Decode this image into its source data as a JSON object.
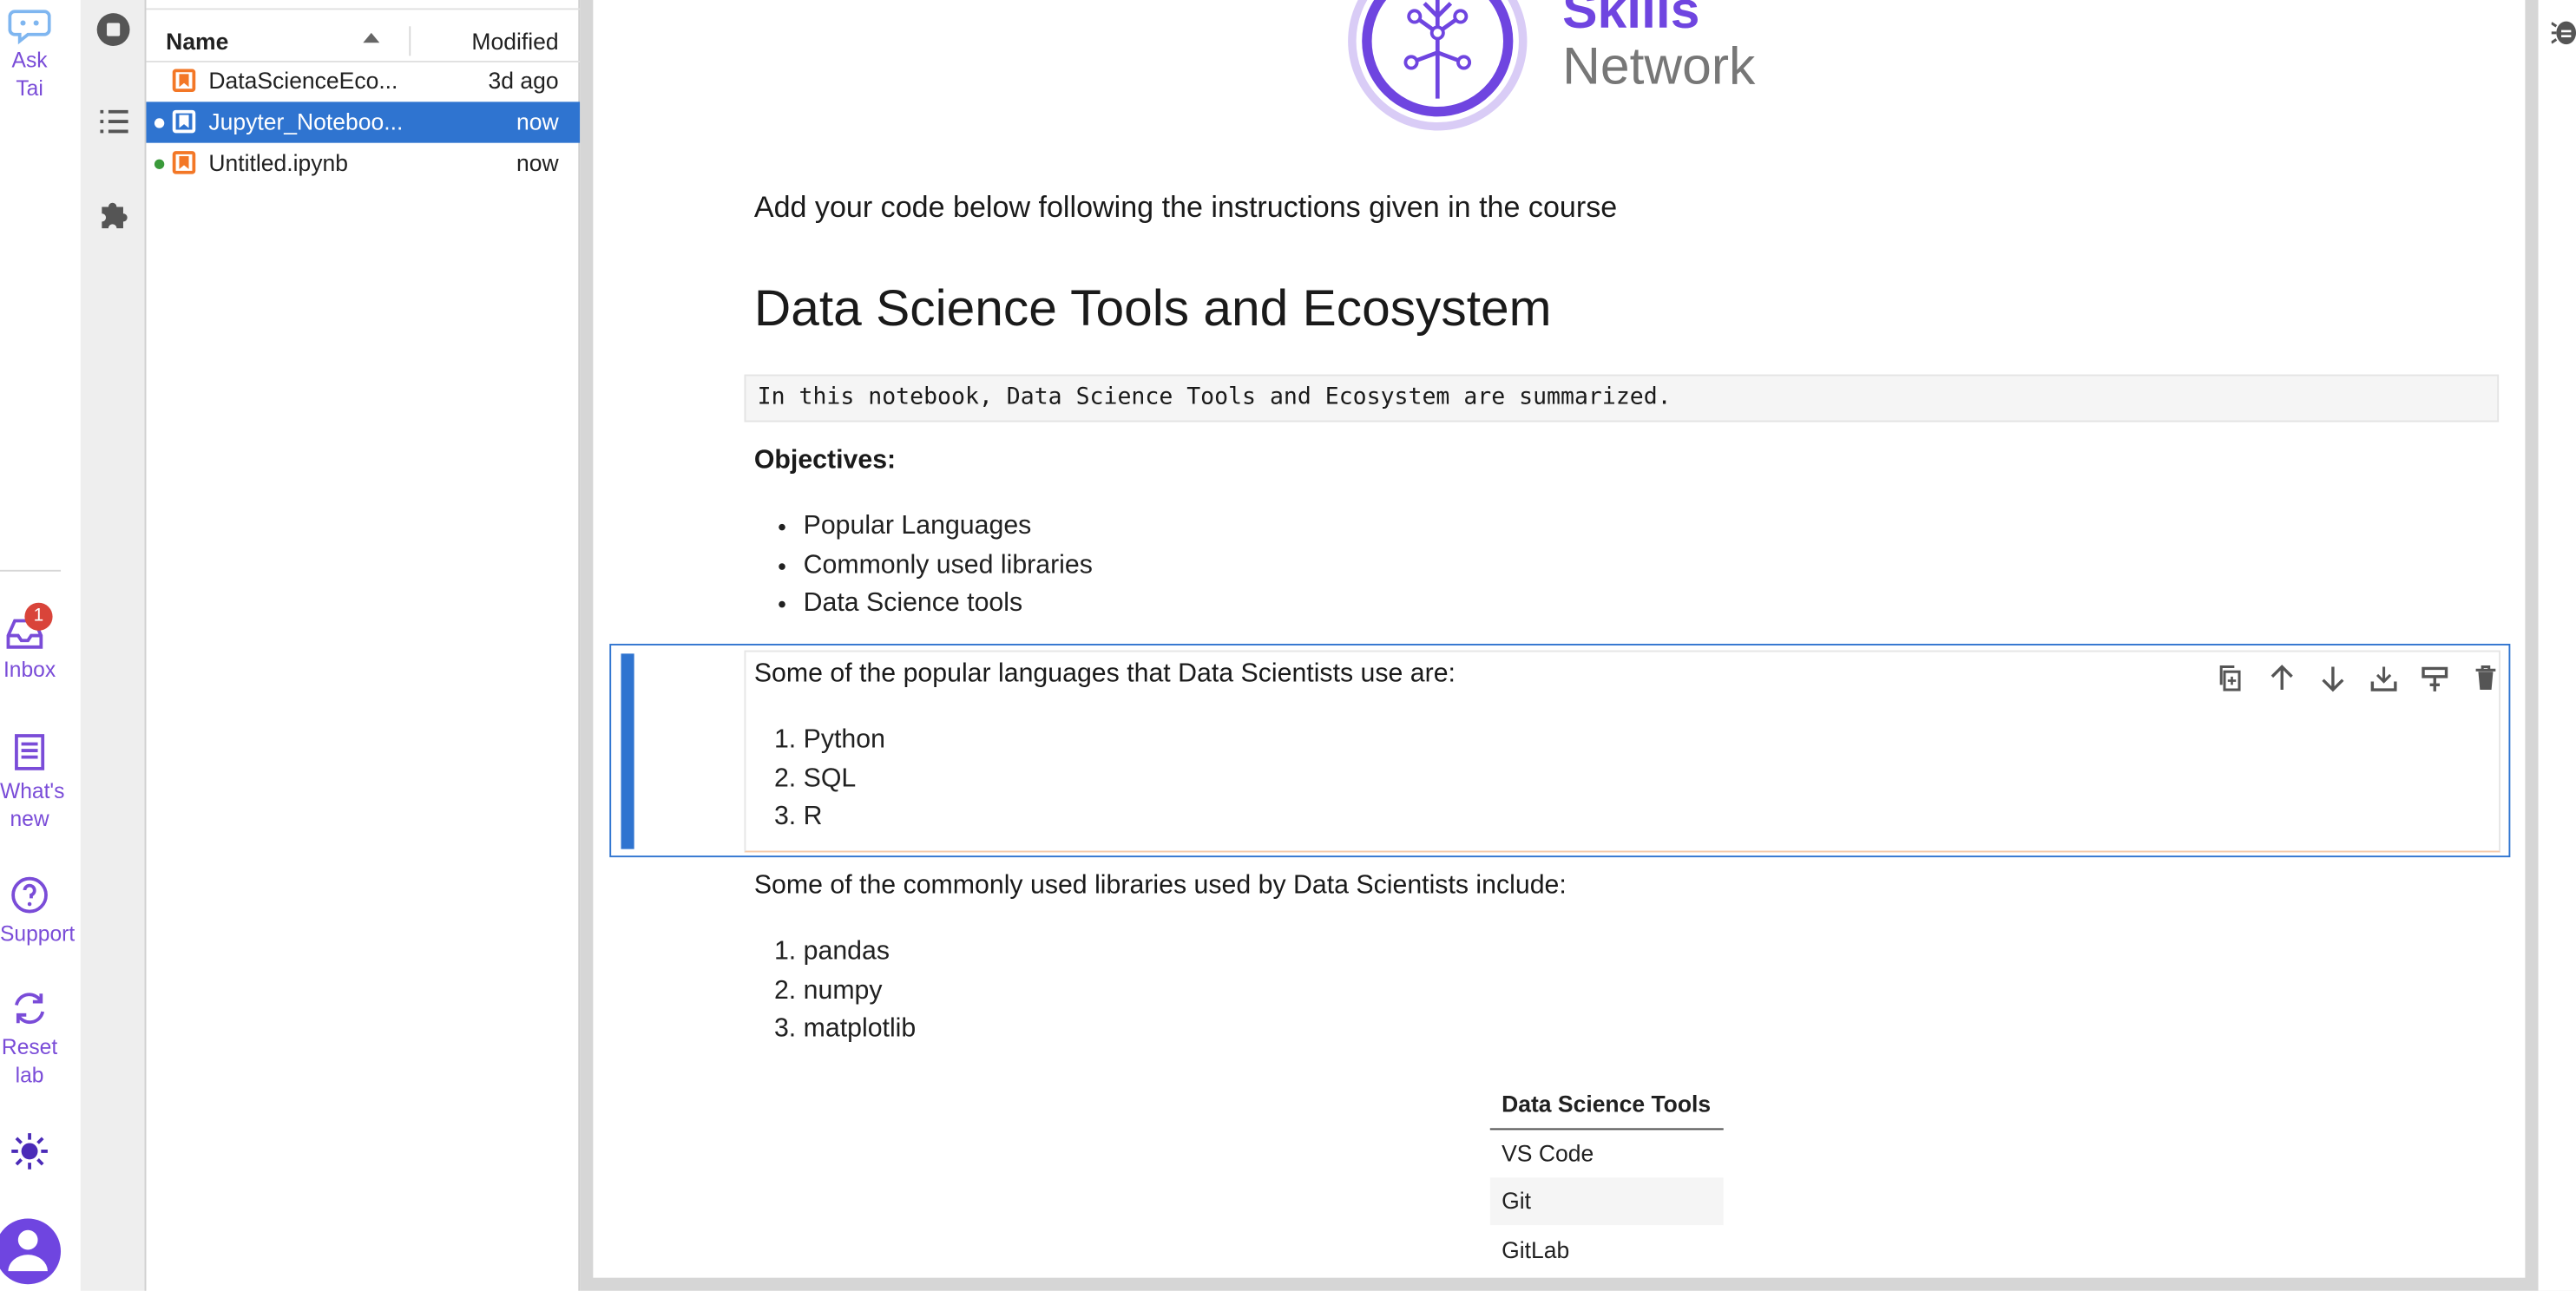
{
  "rail": {
    "ask_tai": "Ask Tai",
    "inbox": "Inbox",
    "inbox_count": "1",
    "whats_new": "What's new",
    "support": "Support",
    "reset_lab": "Reset lab"
  },
  "filebrowser": {
    "col_name": "Name",
    "col_modified": "Modified",
    "files": [
      {
        "name": "DataScienceEco...",
        "modified": "3d ago",
        "running": false,
        "selected": false
      },
      {
        "name": "Jupyter_Noteboo...",
        "modified": "now",
        "running": true,
        "selected": true
      },
      {
        "name": "Untitled.ipynb",
        "modified": "now",
        "running": true,
        "selected": false
      }
    ]
  },
  "notebook": {
    "logo_line1": "Skills",
    "logo_line2": "Network",
    "intro": "Add your code below following the instructions given in the course",
    "heading": "Data Science Tools and Ecosystem",
    "summary_code": "In this notebook, Data Science Tools and Ecosystem are summarized.",
    "objectives_label": "Objectives:",
    "objectives": [
      "Popular Languages",
      "Commonly used libraries",
      "Data Science tools"
    ],
    "languages_intro": "Some of the popular languages that Data Scientists use are:",
    "languages": [
      "Python",
      "SQL",
      "R"
    ],
    "libraries_intro": "Some of the commonly used libraries used by Data Scientists include:",
    "libraries": [
      "pandas",
      "numpy",
      "matplotlib"
    ],
    "tools_header": "Data Science Tools",
    "tools": [
      "VS Code",
      "Git",
      "GitLab"
    ]
  },
  "colors": {
    "accent": "#2f74d0",
    "rail_purple": "#7a4cd8",
    "jupyter_orange": "#f37726",
    "badge_red": "#d9443a",
    "running_green": "#3a9a3a"
  }
}
